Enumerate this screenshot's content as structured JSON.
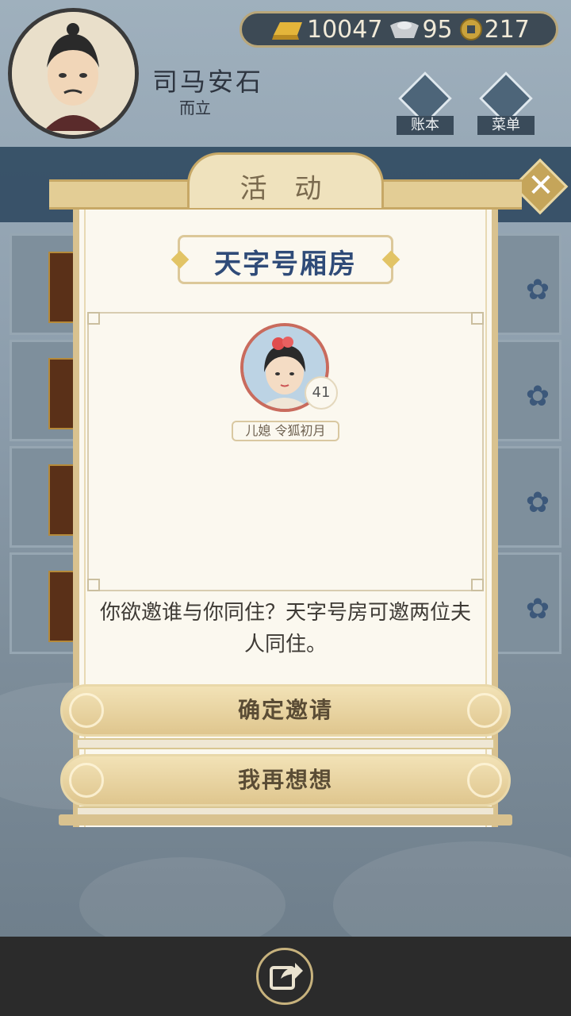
{
  "player": {
    "name": "司马安石",
    "age_title": "而立"
  },
  "currency": {
    "gold": "10047",
    "silver": "95",
    "coin": "217"
  },
  "header_buttons": {
    "ledger": "账本",
    "menu": "菜单"
  },
  "dialog": {
    "title": "活 动",
    "room_name": "天字号厢房",
    "member": {
      "age": "41",
      "tag": "儿媳 令狐初月"
    },
    "question": "你欲邀谁与你同住？天字号房可邀两位夫人同住。",
    "confirm_label": "确定邀请",
    "cancel_label": "我再想想"
  },
  "colors": {
    "accent_gold": "#dfc68e",
    "title_blue": "#2f4b78",
    "bg_blue": "#2f4960"
  }
}
